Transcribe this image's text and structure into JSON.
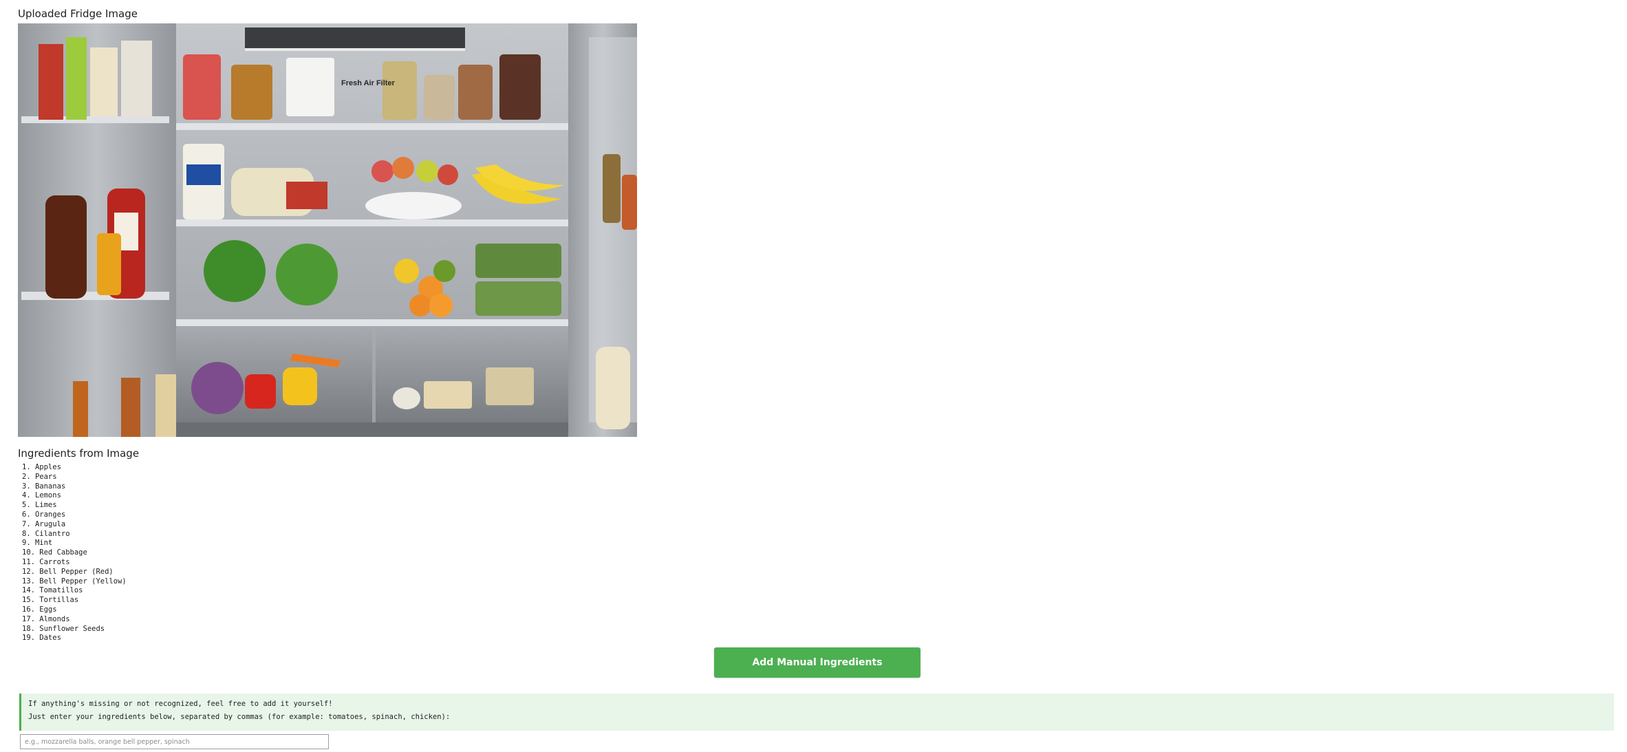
{
  "image_section": {
    "title": "Uploaded Fridge Image",
    "photo_label": "Fresh Air Filter"
  },
  "ingredients_section": {
    "title": "Ingredients from Image",
    "items": [
      "1. Apples",
      "2. Pears",
      "3. Bananas",
      "4. Lemons",
      "5. Limes",
      "6. Oranges",
      "7. Arugula",
      "8. Cilantro",
      "9. Mint",
      "10. Red Cabbage",
      "11. Carrots",
      "12. Bell Pepper (Red)",
      "13. Bell Pepper (Yellow)",
      "14. Tomatillos",
      "15. Tortillas",
      "16. Eggs",
      "17. Almonds",
      "18. Sunflower Seeds",
      "19. Dates"
    ]
  },
  "actions": {
    "add_manual_label": "Add Manual Ingredients"
  },
  "info": {
    "line1": "If anything's missing or not recognized, feel free to add it yourself!",
    "line2": "Just enter your ingredients below, separated by commas (for example: tomatoes, spinach, chicken):"
  },
  "manual_input": {
    "placeholder": "e.g., mozzarella balls, orange bell pepper, spinach",
    "value": ""
  },
  "colors": {
    "accent": "#4caf50",
    "info_background": "#e8f5e9"
  }
}
